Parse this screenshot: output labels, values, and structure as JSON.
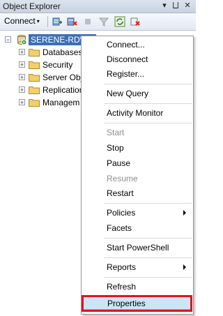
{
  "window": {
    "title": "Object Explorer",
    "pin_glyph": "⨆",
    "close_glyph": "✕",
    "dropdown_glyph": "▾"
  },
  "toolbar": {
    "connect_label": "Connect",
    "connect_arrow": "▾",
    "icons": [
      "register-server-icon",
      "disconnect-server-icon",
      "stop-icon",
      "filter-icon",
      "refresh-icon",
      "delete-icon"
    ]
  },
  "tree": {
    "server": {
      "label": "SERENE-RD\\SQ",
      "expander": "−"
    },
    "children": [
      {
        "label": "Databases",
        "expander": "+"
      },
      {
        "label": "Security",
        "expander": "+"
      },
      {
        "label": "Server Obj",
        "expander": "+"
      },
      {
        "label": "Replication",
        "expander": "+"
      },
      {
        "label": "Managem",
        "expander": "+"
      }
    ]
  },
  "context_menu": {
    "items": [
      {
        "label": "Connect...",
        "enabled": true
      },
      {
        "label": "Disconnect",
        "enabled": true
      },
      {
        "label": "Register...",
        "enabled": true
      },
      {
        "label": "New Query",
        "enabled": true
      },
      {
        "label": "Activity Monitor",
        "enabled": true
      },
      {
        "label": "Start",
        "enabled": false
      },
      {
        "label": "Stop",
        "enabled": true
      },
      {
        "label": "Pause",
        "enabled": true
      },
      {
        "label": "Resume",
        "enabled": false
      },
      {
        "label": "Restart",
        "enabled": true
      },
      {
        "label": "Policies",
        "enabled": true,
        "submenu": true
      },
      {
        "label": "Facets",
        "enabled": true
      },
      {
        "label": "Start PowerShell",
        "enabled": true
      },
      {
        "label": "Reports",
        "enabled": true,
        "submenu": true
      },
      {
        "label": "Refresh",
        "enabled": true
      },
      {
        "label": "Properties",
        "enabled": true,
        "highlighted": true
      }
    ]
  },
  "colors": {
    "selection": "#3d6fb4",
    "menu_highlight": "#cfe3f7",
    "annotation_box": "#e0141e",
    "disabled_text": "#8d8d8d"
  }
}
